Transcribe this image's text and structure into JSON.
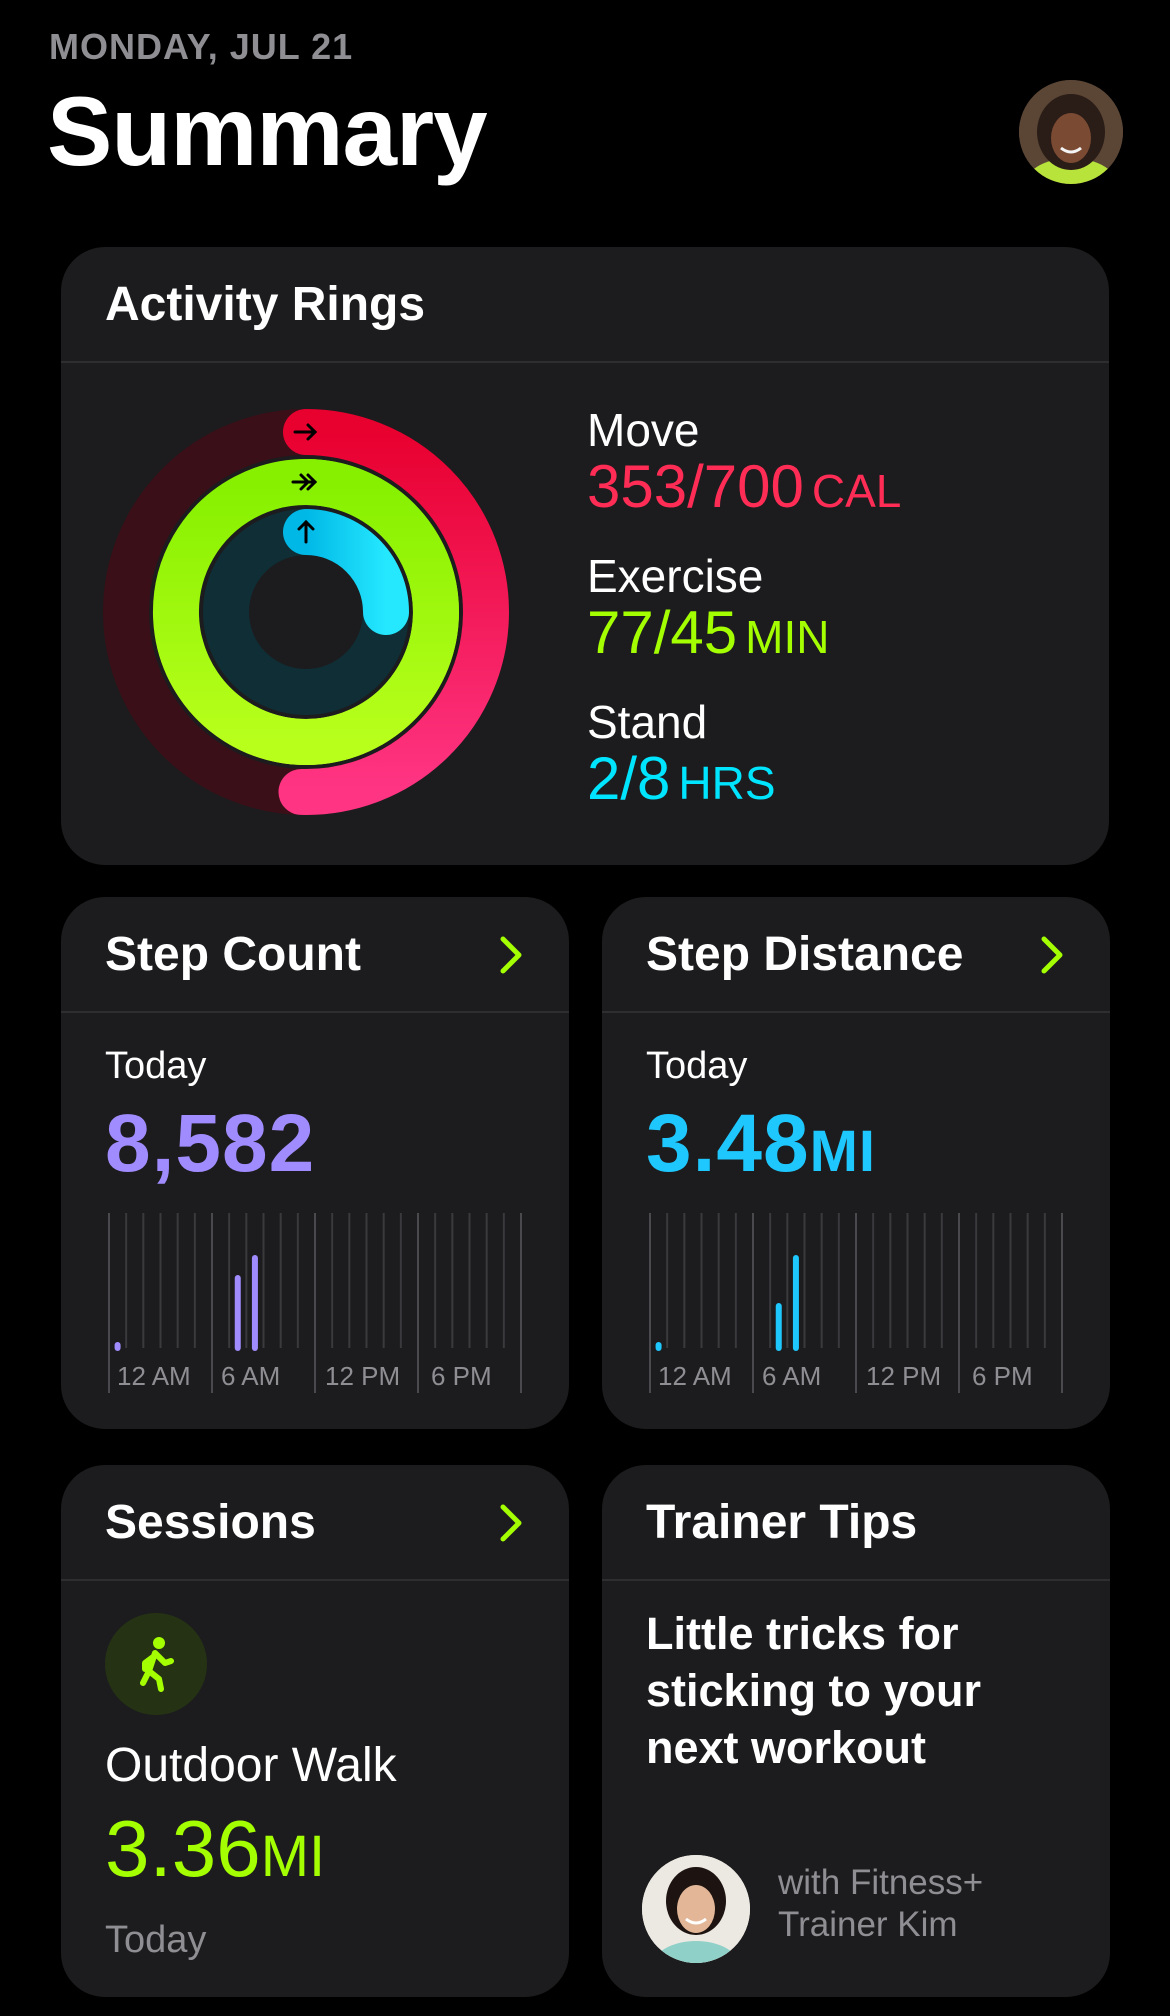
{
  "header": {
    "date": "MONDAY, JUL 21",
    "title": "Summary"
  },
  "activity": {
    "title": "Activity Rings",
    "move": {
      "label": "Move",
      "value": "353/700",
      "unit": "CAL",
      "progress": 0.504,
      "color": "#ff2d55"
    },
    "exercise": {
      "label": "Exercise",
      "value": "77/45",
      "unit": "MIN",
      "progress": 1.711,
      "color": "#a4ff00"
    },
    "stand": {
      "label": "Stand",
      "value": "2/8",
      "unit": "HRS",
      "progress": 0.25,
      "color": "#00e0ff"
    }
  },
  "step_count": {
    "title": "Step Count",
    "period": "Today",
    "value": "8,582",
    "color": "#a18cff",
    "axis_labels": [
      "12 AM",
      "6 AM",
      "12 PM",
      "6 PM"
    ]
  },
  "step_distance": {
    "title": "Step Distance",
    "period": "Today",
    "value": "3.48",
    "unit": "MI",
    "color": "#1ec8ff",
    "axis_labels": [
      "12 AM",
      "6 AM",
      "12 PM",
      "6 PM"
    ]
  },
  "sessions": {
    "title": "Sessions",
    "icon": "walking-figure-icon",
    "name": "Outdoor Walk",
    "value": "3.36",
    "unit": "MI",
    "date": "Today"
  },
  "trainer_tips": {
    "title": "Trainer Tips",
    "tip": "Little tricks for sticking to your next workout",
    "with_line1": "with Fitness+",
    "with_line2": "Trainer Kim"
  },
  "colors": {
    "accent_green": "#a4ff00",
    "card_bg": "#1c1c1e",
    "secondary_text": "#8e8e93"
  }
}
